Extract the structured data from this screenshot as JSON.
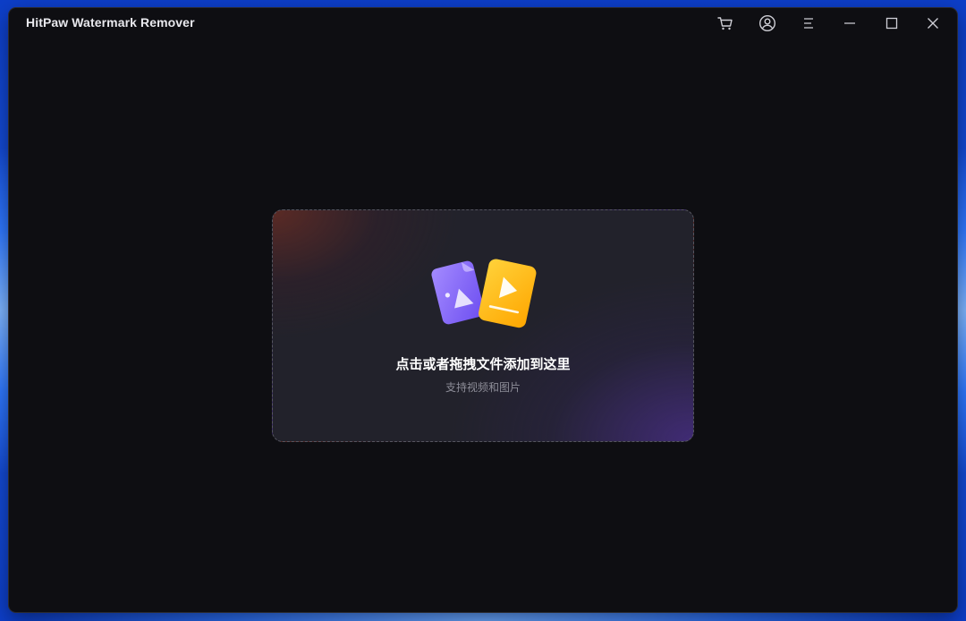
{
  "window": {
    "title": "HitPaw Watermark Remover"
  },
  "titlebar": {
    "buttons": [
      {
        "name": "cart",
        "icon": "cart-icon"
      },
      {
        "name": "account",
        "icon": "user-circle-icon"
      },
      {
        "name": "menu",
        "icon": "menu-icon"
      },
      {
        "name": "minimize",
        "icon": "minimize-icon"
      },
      {
        "name": "maximize",
        "icon": "maximize-icon"
      },
      {
        "name": "close",
        "icon": "close-icon"
      }
    ]
  },
  "drop_zone": {
    "title": "点击或者拖拽文件添加到这里",
    "subtitle": "支持视频和图片",
    "icons": [
      "image-file-icon",
      "video-file-icon"
    ]
  },
  "colors": {
    "window_bg": "#0e0e12",
    "image_icon": "#8b6cf6",
    "video_icon": "#ffb400",
    "text_primary": "#ffffff",
    "text_secondary": "#8d8d98"
  }
}
